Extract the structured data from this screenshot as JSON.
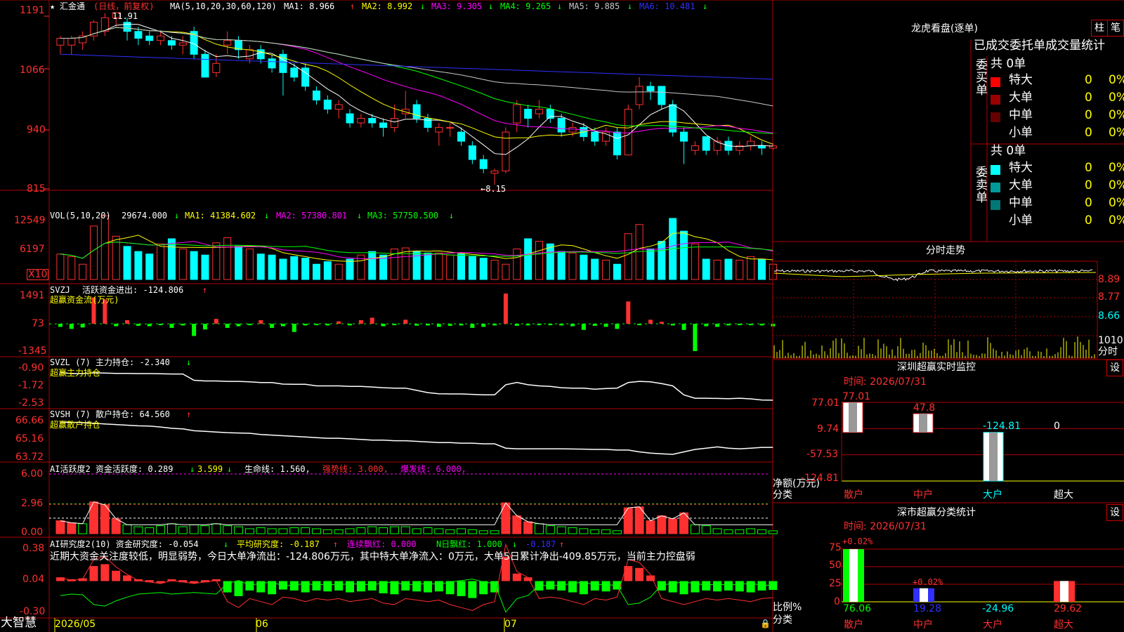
{
  "colors": {
    "up": "#ff3030",
    "down": "#00ffff",
    "bg": "#000000",
    "frame": "#b00000",
    "axis": "#ff3030",
    "green": "#00ff00",
    "magenta": "#ff00ff",
    "yellow": "#ffff00",
    "white": "#ffffff"
  },
  "header": {
    "star": "★",
    "name": "汇金通",
    "period": "(日线，前复权)",
    "ma_label": "MA(5,10,20,30,60,120)",
    "ma1": "MA1: 8.966",
    "ma2": "MA2: 8.992",
    "ma3": "MA3: 9.305",
    "ma4": "MA4: 9.265",
    "ma5": "MA5: 9.885",
    "ma6": "MA6: 10.481",
    "ma1_arrow": "↑",
    "ma2_arrow": "↓",
    "ma3_arrow": "↓",
    "ma4_arrow": "↓",
    "ma5_arrow": "↓",
    "ma6_arrow": "↓",
    "high_label": "11.91",
    "low_label": "←8.15"
  },
  "price_axis": {
    "ticks": [
      "1191",
      "1066",
      "940",
      "815"
    ]
  },
  "vol_panel": {
    "title": "VOL(5,10,20)",
    "v": "29674.000",
    "ma1": "MA1: 41384.602",
    "ma2": "MA2: 57380.801",
    "ma3": "MA3: 57750.500",
    "arrow": "↓",
    "ticks": [
      "12549",
      "6197"
    ],
    "unit": "X10"
  },
  "svzj": {
    "title": "SVZJ",
    "desc": "活跃资金进出: -124.806",
    "arrow": "↑",
    "sub": "超赢资金流(万元)",
    "ticks": [
      "1491",
      "73",
      "-1345"
    ]
  },
  "svzl": {
    "title": "SVZL (7) 主力持仓: -2.340",
    "arrow": "↓",
    "sub": "超赢主力持仓",
    "ticks": [
      "-0.90",
      "-1.72",
      "-2.53"
    ]
  },
  "svsh": {
    "title": "SVSH (7) 散户持仓: 64.560",
    "arrow": "↑",
    "sub": "超赢散户持仓",
    "ticks": [
      "66.66",
      "65.16",
      "63.72"
    ]
  },
  "ai_active": {
    "title": "AI活跃度2 资金活跃度: 0.289",
    "a1": "↓",
    "v2": "3.599",
    "a2": "↓",
    "life": "生命线: 1.560,",
    "strong": "强势线: 3.000,",
    "burst": "爆发线: 6.000,",
    "ticks": [
      "6.00",
      "2.96",
      "0.00"
    ]
  },
  "ai_research": {
    "title": "AI研究度2(10) 资金研究度: -0.054",
    "a1": "↓",
    "avg": "平均研究度: -0.187",
    "a2": "↑",
    "red": "连续飘红: 0.000",
    "nred": "N日飘红: 1.000",
    "a3": "↓",
    "last": "-0.187",
    "a4": "↑",
    "comment": "近期大资金关注度较低，明显弱势，今日大单净流出：-124.806万元，其中特大单净流入：0万元，大单5日累计净出-409.85万元，当前主力控盘弱",
    "ticks": [
      "0.38",
      "0.04",
      "-0.30"
    ]
  },
  "footer": {
    "brand": "大智慧",
    "date1": "2026/05",
    "date2": "06",
    "date3": "07"
  },
  "right": {
    "lhb_title": "龙虎看盘(逐单)",
    "btn_zhu": "柱",
    "btn_bi": "笔",
    "stat_title": "已成交委托单成交量统计",
    "buy_label": "委买单",
    "sell_label": "委卖单",
    "buy_total": "共 0单",
    "sell_total": "共 0单",
    "buy_rows": [
      {
        "name": "特大",
        "count": "0",
        "pct": "0%",
        "color": "#ff0000"
      },
      {
        "name": "大单",
        "count": "0",
        "pct": "0%",
        "color": "#990000"
      },
      {
        "name": "中单",
        "count": "0",
        "pct": "0%",
        "color": "#660000"
      },
      {
        "name": "小单",
        "count": "0",
        "pct": "0%",
        "color": "#000000"
      }
    ],
    "sell_rows": [
      {
        "name": "特大",
        "count": "0",
        "pct": "0%",
        "color": "#00ffff"
      },
      {
        "name": "大单",
        "count": "0",
        "pct": "0%",
        "color": "#009999"
      },
      {
        "name": "中单",
        "count": "0",
        "pct": "0%",
        "color": "#007777"
      },
      {
        "name": "小单",
        "count": "0",
        "pct": "0%",
        "color": "#000000"
      }
    ],
    "fs_title": "分时走势",
    "fs_ticks": [
      "8.89",
      "8.77",
      "8.66"
    ],
    "fs_vol": "1010",
    "fs_vol_unit": "分时",
    "sz_title": "深圳超赢实时监控",
    "sz_btn": "设",
    "sz_time": "时间: 2026/07/31",
    "sz_ticks": [
      "77.01",
      "9.74",
      "-57.53",
      "-124.81"
    ],
    "sz_values": [
      "77.01",
      "47.8",
      "-124.81",
      "0"
    ],
    "sz_cats": [
      "散户",
      "中户",
      "大户",
      "超大"
    ],
    "sz_ylabel": "净额(万元)",
    "sz_xlabel": "分类",
    "ss_title": "深市超赢分类统计",
    "ss_btn": "设",
    "ss_time": "时间: 2026/07/31",
    "ss_ticks": [
      "75",
      "50",
      "25",
      "0"
    ],
    "ss_tops": [
      "+0.02%",
      "+0.02%"
    ],
    "ss_values": [
      "76.06",
      "19.28",
      "-24.96",
      "29.62"
    ],
    "ss_cats": [
      "散户",
      "中户",
      "大户",
      "超大"
    ],
    "ss_ylabel": "比例%",
    "ss_xlabel": "分类"
  },
  "chart_data": [
    {
      "type": "candlestick",
      "title": "汇金通",
      "y_ticks": [
        11.91,
        10.66,
        9.4,
        8.15
      ],
      "candles": [
        [
          11.2,
          11.35,
          11.0,
          11.4
        ],
        [
          11.2,
          11.35,
          11.0,
          11.4
        ],
        [
          11.25,
          11.4,
          11.1,
          11.5
        ],
        [
          11.4,
          11.7,
          11.3,
          11.75
        ],
        [
          11.5,
          11.8,
          11.4,
          11.9
        ],
        [
          11.8,
          11.91,
          11.6,
          11.91
        ],
        [
          11.7,
          11.5,
          11.3,
          11.8
        ],
        [
          11.5,
          11.35,
          11.2,
          11.6
        ],
        [
          11.4,
          11.3,
          11.2,
          11.5
        ],
        [
          11.3,
          11.4,
          11.2,
          11.5
        ],
        [
          11.3,
          11.2,
          11.1,
          11.4
        ],
        [
          11.2,
          11.25,
          11.0,
          11.4
        ],
        [
          11.5,
          11.0,
          10.9,
          11.6
        ],
        [
          11.0,
          10.5,
          10.5,
          11.1
        ],
        [
          10.6,
          10.8,
          10.5,
          11.0
        ],
        [
          11.2,
          11.3,
          11.0,
          11.5
        ],
        [
          11.3,
          11.1,
          10.9,
          11.4
        ],
        [
          10.9,
          11.1,
          10.8,
          11.2
        ],
        [
          11.1,
          10.9,
          10.8,
          11.2
        ],
        [
          10.9,
          10.7,
          10.6,
          11.0
        ],
        [
          11.0,
          10.6,
          10.1,
          11.1
        ],
        [
          10.7,
          10.5,
          10.4,
          10.8
        ],
        [
          10.7,
          10.3,
          10.2,
          10.8
        ],
        [
          10.2,
          10.0,
          9.9,
          10.3
        ],
        [
          10.0,
          9.8,
          9.7,
          10.1
        ],
        [
          9.8,
          9.9,
          9.6,
          10.0
        ],
        [
          9.7,
          9.5,
          9.4,
          9.8
        ],
        [
          9.5,
          9.6,
          9.4,
          9.7
        ],
        [
          9.6,
          9.5,
          9.4,
          9.7
        ],
        [
          9.5,
          9.4,
          9.2,
          9.6
        ],
        [
          9.4,
          9.6,
          9.3,
          9.9
        ],
        [
          9.7,
          9.8,
          9.6,
          10.2
        ],
        [
          9.9,
          9.6,
          9.5,
          10.0
        ],
        [
          9.6,
          9.4,
          9.3,
          9.7
        ],
        [
          9.3,
          9.4,
          9.0,
          9.5
        ],
        [
          9.4,
          9.4,
          9.2,
          9.5
        ],
        [
          9.3,
          9.1,
          9.0,
          9.4
        ],
        [
          9.0,
          8.7,
          8.6,
          9.1
        ],
        [
          8.7,
          8.5,
          8.4,
          8.8
        ],
        [
          8.4,
          8.45,
          8.15,
          8.5
        ],
        [
          8.45,
          9.3,
          8.4,
          9.4
        ],
        [
          9.5,
          9.9,
          9.3,
          10.0
        ],
        [
          9.8,
          9.6,
          9.4,
          9.9
        ],
        [
          9.7,
          9.8,
          9.6,
          10.0
        ],
        [
          9.8,
          9.6,
          9.5,
          9.9
        ],
        [
          9.6,
          9.3,
          9.2,
          9.7
        ],
        [
          9.3,
          9.4,
          9.2,
          9.5
        ],
        [
          9.4,
          9.2,
          9.1,
          9.5
        ],
        [
          9.3,
          9.1,
          9.0,
          9.4
        ],
        [
          9.1,
          9.3,
          9.0,
          9.4
        ],
        [
          9.3,
          8.8,
          8.7,
          9.4
        ],
        [
          8.8,
          9.8,
          8.8,
          9.9
        ],
        [
          9.9,
          10.3,
          9.8,
          10.5
        ],
        [
          10.3,
          10.2,
          10.0,
          10.4
        ],
        [
          10.3,
          9.9,
          9.8,
          10.3
        ],
        [
          9.9,
          9.3,
          9.2,
          10.0
        ],
        [
          9.3,
          9.1,
          8.6,
          9.4
        ],
        [
          8.9,
          9.0,
          8.8,
          9.1
        ],
        [
          9.2,
          8.9,
          8.8,
          9.2
        ],
        [
          8.9,
          9.1,
          8.8,
          9.2
        ],
        [
          9.1,
          8.9,
          8.8,
          9.2
        ],
        [
          8.9,
          9.0,
          8.8,
          9.1
        ],
        [
          9.0,
          9.1,
          8.9,
          9.2
        ],
        [
          9.0,
          8.95,
          8.8,
          9.1
        ],
        [
          8.95,
          9.0,
          8.9,
          9.05
        ]
      ]
    },
    {
      "type": "bar",
      "title": "VOL(5,10,20)",
      "series": [
        {
          "name": "VOL",
          "values": [
            50,
            45,
            30,
            105,
            125,
            85,
            65,
            55,
            50,
            70,
            80,
            60,
            55,
            48,
            72,
            82,
            65,
            60,
            50,
            48,
            40,
            45,
            42,
            30,
            35,
            30,
            40,
            48,
            55,
            48,
            60,
            62,
            55,
            52,
            52,
            48,
            50,
            45,
            42,
            38,
            30,
            60,
            80,
            75,
            70,
            55,
            52,
            48,
            40,
            38,
            30,
            90,
            108,
            60,
            75,
            120,
            95,
            70,
            40,
            38,
            40,
            38,
            45,
            40,
            30
          ]
        }
      ],
      "ylim": [
        0,
        125.49
      ]
    },
    {
      "type": "bar",
      "title": "超赢资金流(万元)",
      "series": [
        {
          "name": "活跃资金进出",
          "values": [
            -150,
            -250,
            -180,
            1300,
            1200,
            -120,
            180,
            -100,
            -120,
            -60,
            -200,
            -80,
            -600,
            -280,
            240,
            -200,
            -120,
            -60,
            180,
            -200,
            -120,
            -400,
            -80,
            -60,
            -80,
            120,
            -80,
            180,
            300,
            -120,
            -60,
            200,
            -90,
            -80,
            -150,
            -100,
            -80,
            -200,
            -150,
            -80,
            1491,
            -100,
            -80,
            -60,
            -70,
            -80,
            -120,
            -300,
            -100,
            -150,
            -250,
            1100,
            -60,
            200,
            100,
            -80,
            -300,
            -1345,
            -120,
            -150,
            -80,
            -60,
            -70,
            -80,
            -124.806
          ]
        }
      ],
      "ylim": [
        -1345,
        1491
      ]
    },
    {
      "type": "line",
      "title": "SVZL (7) 主力持仓",
      "series": [
        {
          "name": "主力持仓",
          "values": [
            -1.1,
            -1.15,
            -1.15,
            -1.12,
            -1.13,
            -1.14,
            -1.14,
            -1.15,
            -1.15,
            -1.16,
            -1.17,
            -1.17,
            -1.45,
            -1.48,
            -1.48,
            -1.5,
            -1.5,
            -1.52,
            -1.55,
            -1.55,
            -1.62,
            -1.63,
            -1.63,
            -1.7,
            -1.7,
            -1.7,
            -1.72,
            -1.72,
            -1.75,
            -1.78,
            -1.8,
            -1.8,
            -1.9,
            -2.0,
            -2.05,
            -2.06,
            -2.06,
            -2.08,
            -2.1,
            -2.1,
            -1.65,
            -1.55,
            -1.65,
            -1.7,
            -1.72,
            -1.78,
            -1.8,
            -1.8,
            -1.85,
            -1.82,
            -1.8,
            -1.55,
            -1.5,
            -1.52,
            -1.6,
            -1.7,
            -2.1,
            -2.25,
            -2.25,
            -2.26,
            -2.27,
            -2.25,
            -2.28,
            -2.33,
            -2.34
          ]
        }
      ],
      "ylim": [
        -2.53,
        -0.9
      ]
    },
    {
      "type": "line",
      "title": "SVSH (7) 散户持仓",
      "series": [
        {
          "name": "散户持仓",
          "values": [
            66.6,
            66.58,
            66.55,
            66.5,
            66.45,
            66.4,
            66.35,
            66.3,
            66.28,
            66.2,
            66.1,
            66.05,
            65.9,
            65.85,
            65.8,
            65.75,
            65.72,
            65.7,
            65.6,
            65.55,
            65.5,
            65.45,
            65.4,
            65.35,
            65.3,
            65.3,
            65.25,
            65.2,
            65.15,
            65.15,
            65.1,
            65.1,
            65.05,
            65.0,
            64.95,
            64.95,
            64.9,
            64.9,
            64.85,
            64.85,
            64.5,
            64.45,
            64.45,
            64.45,
            64.45,
            64.45,
            64.43,
            64.42,
            64.4,
            64.4,
            64.35,
            64.35,
            64.2,
            64.1,
            64.05,
            64.0,
            64.2,
            64.4,
            64.5,
            64.6,
            64.5,
            64.45,
            64.5,
            64.56,
            64.56
          ]
        }
      ],
      "ylim": [
        63.72,
        66.66
      ]
    },
    {
      "type": "bar",
      "title": "AI活跃度2",
      "series": [
        {
          "name": "资金活跃度",
          "values": [
            1.3,
            1.1,
            1.0,
            3.2,
            2.9,
            1.5,
            0.9,
            0.7,
            0.6,
            0.8,
            1.0,
            0.7,
            0.9,
            0.8,
            1.0,
            0.8,
            0.7,
            0.5,
            0.6,
            0.5,
            0.5,
            0.6,
            0.6,
            0.5,
            0.4,
            0.4,
            0.5,
            0.6,
            0.7,
            0.6,
            0.7,
            0.7,
            0.5,
            0.6,
            0.5,
            0.4,
            0.5,
            0.4,
            0.3,
            0.3,
            3.1,
            1.8,
            1.2,
            1.0,
            0.8,
            0.7,
            0.6,
            0.5,
            0.4,
            0.4,
            0.3,
            2.6,
            2.7,
            1.3,
            1.8,
            1.5,
            2.1,
            0.9,
            0.8,
            0.5,
            0.4,
            0.4,
            0.5,
            0.4,
            0.289
          ]
        },
        {
          "name": "生命线",
          "values": [
            1.56
          ]
        },
        {
          "name": "强势线",
          "values": [
            3.0
          ]
        },
        {
          "name": "爆发线",
          "values": [
            6.0
          ]
        }
      ],
      "ylim": [
        0,
        6.0
      ]
    },
    {
      "type": "bar",
      "title": "AI研究度2(10)",
      "series": [
        {
          "name": "资金研究度",
          "values": [
            0.08,
            0.06,
            0.07,
            0.2,
            0.22,
            0.15,
            0.1,
            0.06,
            0.05,
            0.04,
            0.06,
            0.05,
            0.04,
            0.05,
            0.06,
            -0.08,
            -0.12,
            -0.06,
            -0.08,
            -0.1,
            -0.05,
            -0.06,
            -0.08,
            -0.06,
            -0.07,
            -0.06,
            -0.08,
            -0.07,
            -0.06,
            -0.09,
            -0.1,
            -0.06,
            -0.07,
            -0.08,
            -0.07,
            -0.1,
            -0.12,
            -0.14,
            -0.1,
            -0.08,
            0.3,
            0.12,
            0.08,
            -0.06,
            -0.05,
            -0.06,
            -0.08,
            -0.1,
            -0.06,
            -0.07,
            -0.05,
            0.2,
            0.18,
            0.1,
            -0.06,
            -0.08,
            -0.1,
            -0.08,
            -0.06,
            -0.07,
            -0.06,
            -0.07,
            -0.08,
            -0.06,
            -0.054
          ]
        }
      ],
      "ylim": [
        -0.3,
        0.38
      ]
    },
    {
      "type": "bar",
      "title": "深圳超赢实时监控",
      "categories": [
        "散户",
        "中户",
        "大户",
        "超大"
      ],
      "values": [
        77.01,
        47.8,
        -124.81,
        0
      ],
      "ylim": [
        -124.81,
        77.01
      ]
    },
    {
      "type": "bar",
      "title": "深市超赢分类统计",
      "categories": [
        "散户",
        "中户",
        "大户",
        "超大"
      ],
      "values": [
        76.06,
        19.28,
        -24.96,
        29.62
      ],
      "ylim": [
        0,
        75
      ]
    }
  ]
}
